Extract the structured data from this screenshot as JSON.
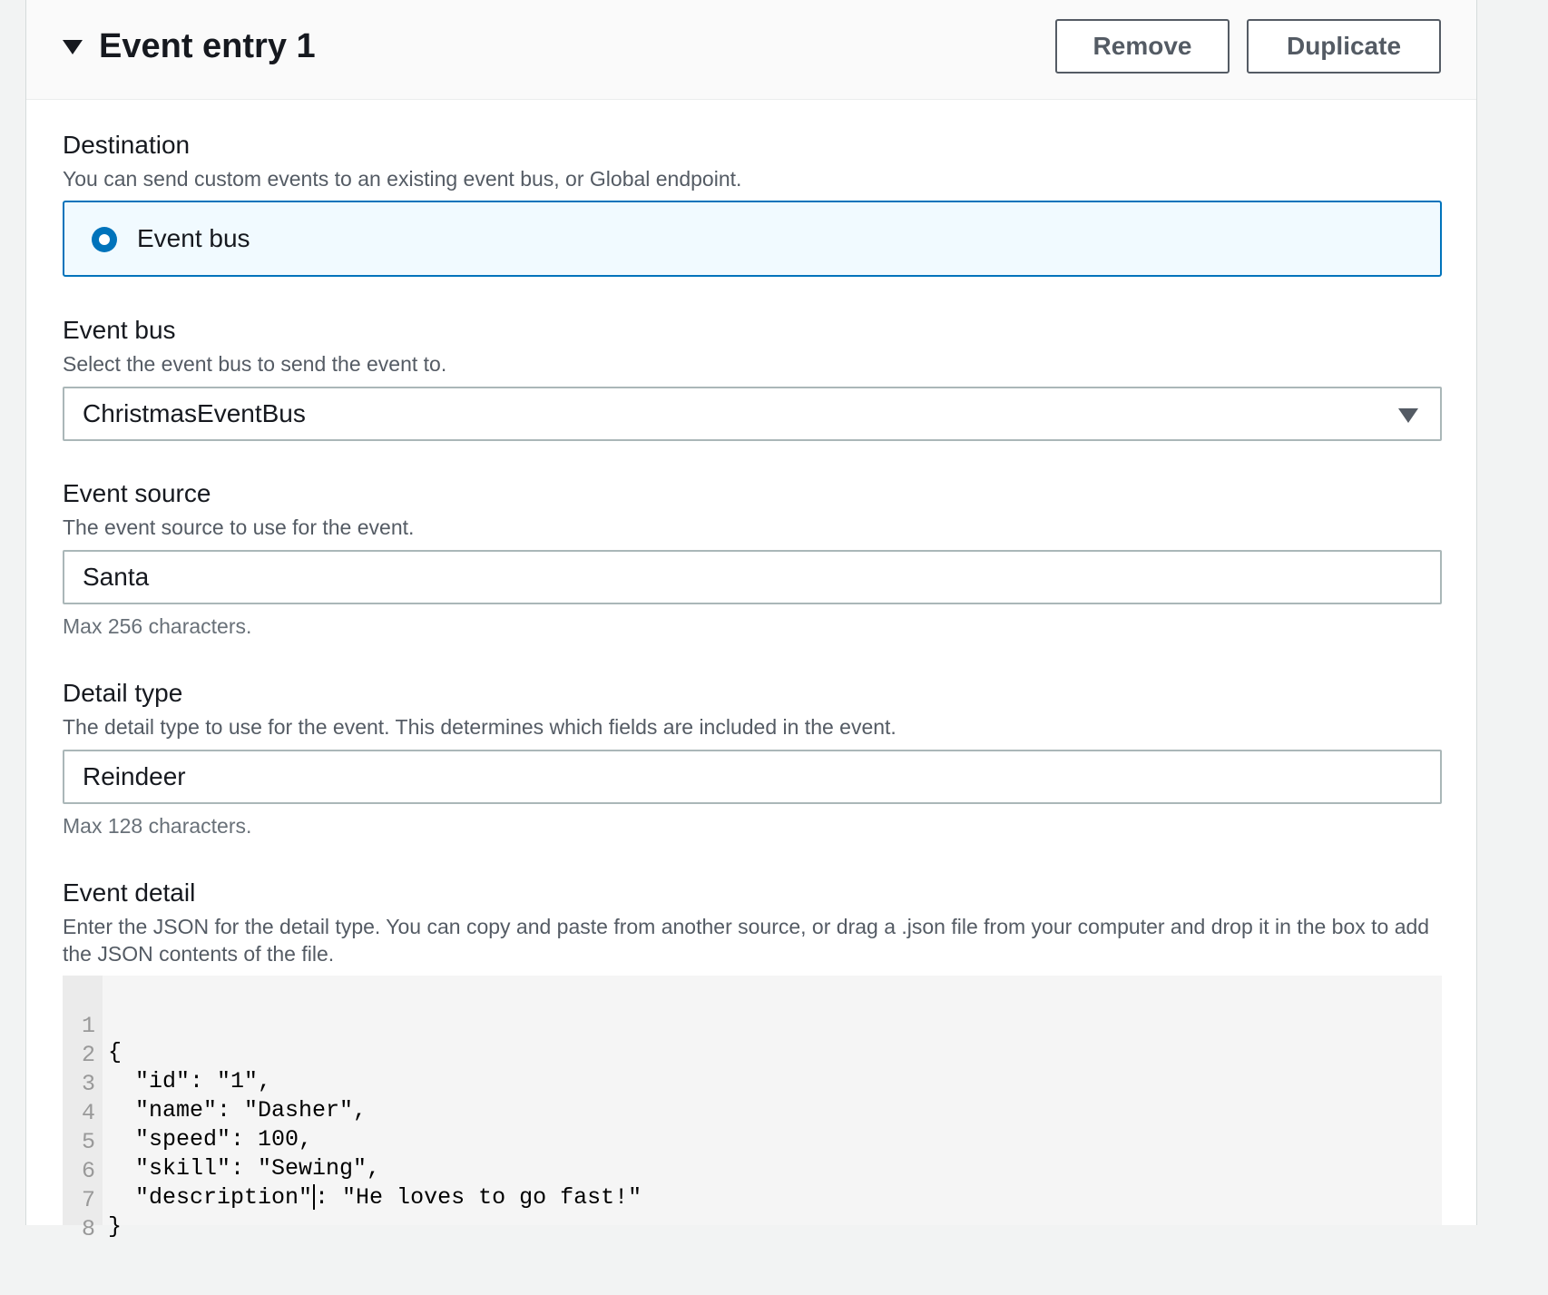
{
  "header": {
    "title": "Event entry 1",
    "remove_label": "Remove",
    "duplicate_label": "Duplicate"
  },
  "destination": {
    "label": "Destination",
    "description": "You can send custom events to an existing event bus, or Global endpoint.",
    "option_label": "Event bus",
    "selected": true
  },
  "event_bus": {
    "label": "Event bus",
    "description": "Select the event bus to send the event to.",
    "value": "ChristmasEventBus"
  },
  "event_source": {
    "label": "Event source",
    "description": "The event source to use for the event.",
    "value": "Santa",
    "constraint": "Max 256 characters."
  },
  "detail_type": {
    "label": "Detail type",
    "description": "The detail type to use for the event. This determines which fields are included in the event.",
    "value": "Reindeer",
    "constraint": "Max 128 characters."
  },
  "event_detail": {
    "label": "Event detail",
    "description": "Enter the JSON for the detail type. You can copy and paste from another source, or drag a .json file from your computer and drop it in the box to add the JSON contents of the file.",
    "lines": [
      {
        "n": "1",
        "text": "{"
      },
      {
        "n": "2",
        "text": "  \"id\": \"1\","
      },
      {
        "n": "3",
        "text": "  \"name\": \"Dasher\","
      },
      {
        "n": "4",
        "text": "  \"speed\": 100,"
      },
      {
        "n": "5",
        "text": "  \"skill\": \"Sewing\","
      },
      {
        "n": "6",
        "text_before_cursor": "  \"description\"",
        "text_after_cursor": ": \"He loves to go fast!\""
      },
      {
        "n": "7",
        "text": "}"
      },
      {
        "n": "8",
        "text": ""
      }
    ]
  },
  "colors": {
    "accent": "#0073bb",
    "tile_bg": "#f1faff",
    "border": "#aab7b8",
    "secondary_text": "#545b64"
  }
}
